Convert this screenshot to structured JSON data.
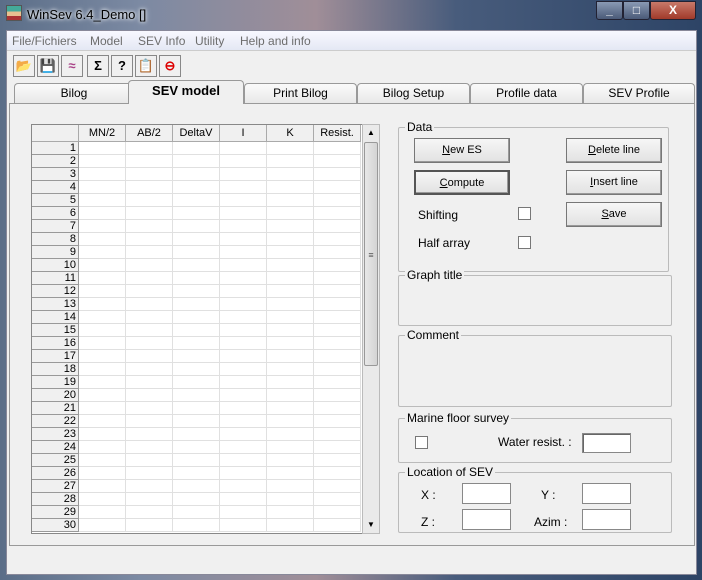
{
  "window": {
    "title": "WinSev 6.4_Demo []",
    "minimize": "_",
    "maximize": "□",
    "close": "X"
  },
  "menu": [
    "File/Fichiers",
    "Model",
    "SEV Info",
    "Utility",
    "Help and info"
  ],
  "toolbar": [
    {
      "icon": "open-folder-icon",
      "glyph": "📂"
    },
    {
      "icon": "save-disk-icon",
      "glyph": "💾"
    },
    {
      "icon": "chart-icon",
      "glyph": "≈"
    },
    {
      "icon": "sigma-icon",
      "glyph": "Σ"
    },
    {
      "icon": "help-pointer-icon",
      "glyph": "?"
    },
    {
      "icon": "clipboard-icon",
      "glyph": "📋"
    },
    {
      "icon": "stop-icon",
      "glyph": "⊖"
    }
  ],
  "tabs": [
    "Bilog",
    "SEV model",
    "Print Bilog",
    "Bilog Setup",
    "Profile data",
    "SEV Profile"
  ],
  "active_tab": "SEV model",
  "grid": {
    "columns": [
      "MN/2",
      "AB/2",
      "DeltaV",
      "I",
      "K",
      "Resist."
    ],
    "rows": [
      "1",
      "2",
      "3",
      "4",
      "5",
      "6",
      "7",
      "8",
      "9",
      "10",
      "11",
      "12",
      "13",
      "14",
      "15",
      "16",
      "17",
      "18",
      "19",
      "20",
      "21",
      "22",
      "23",
      "24",
      "25",
      "26",
      "27",
      "28",
      "29",
      "30"
    ]
  },
  "data_group": {
    "label": "Data",
    "new_es": "New ES",
    "compute": "Compute",
    "delete_line": "Delete line",
    "insert_line": "Insert line",
    "save": "Save",
    "shifting": "Shifting",
    "half_array": "Half array"
  },
  "graph_title": {
    "label": "Graph title"
  },
  "comment": {
    "label": "Comment"
  },
  "marine": {
    "label": "Marine floor survey",
    "water_resist": "Water resist. :"
  },
  "location": {
    "label": "Location of SEV",
    "x": "X :",
    "y": "Y :",
    "z": "Z :",
    "azim": "Azim :"
  }
}
